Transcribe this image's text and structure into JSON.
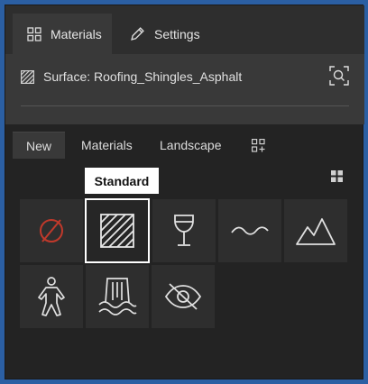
{
  "top_tabs": [
    {
      "label": "Materials",
      "icon": "grid-icon",
      "active": true
    },
    {
      "label": "Settings",
      "icon": "pencil-icon",
      "active": false
    }
  ],
  "surface": {
    "label": "Surface: Roofing_Shingles_Asphalt",
    "icon": "hatch-icon",
    "search_icon": "search-icon"
  },
  "sub_tabs": [
    {
      "label": "New",
      "active": true
    },
    {
      "label": "Materials",
      "active": false
    },
    {
      "label": "Landscape",
      "active": false
    },
    {
      "label": "",
      "icon": "add-grid-icon",
      "active": false
    }
  ],
  "tooltip": "Standard",
  "tiles": [
    {
      "name": "none",
      "icon": "none-icon",
      "selected": false
    },
    {
      "name": "standard",
      "icon": "hatch-icon",
      "selected": true
    },
    {
      "name": "glass",
      "icon": "glass-icon",
      "selected": false
    },
    {
      "name": "water",
      "icon": "water-icon",
      "selected": false
    },
    {
      "name": "terrain",
      "icon": "mountain-icon",
      "selected": false
    },
    {
      "name": "person",
      "icon": "person-icon",
      "selected": false
    },
    {
      "name": "waterfall",
      "icon": "waterfall-icon",
      "selected": false
    },
    {
      "name": "hidden",
      "icon": "eye-off-icon",
      "selected": false
    }
  ],
  "colors": {
    "panel": "#232323",
    "tab_active": "#393939",
    "accent_red": "#c0392b",
    "frame": "#2b5fa3"
  }
}
